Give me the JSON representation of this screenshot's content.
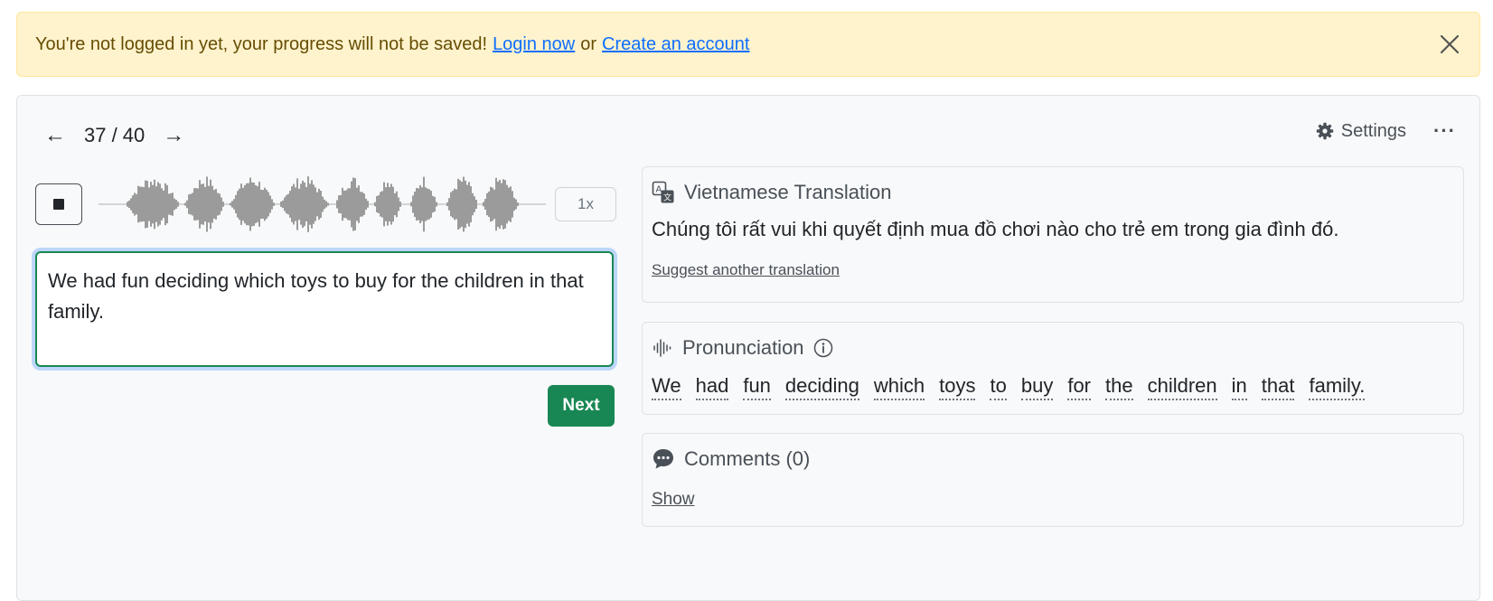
{
  "alert": {
    "message": "You're not logged in yet, your progress will not be saved!",
    "login_label": "Login now",
    "or_text": "or",
    "create_label": "Create an account"
  },
  "nav": {
    "prev_arrow": "←",
    "progress": "37 / 40",
    "next_arrow": "→"
  },
  "toolbar": {
    "settings_label": "Settings",
    "more_label": "···"
  },
  "player": {
    "speed_label": "1x"
  },
  "answer": {
    "value": "We had fun deciding which toys to buy for the children in that family."
  },
  "next_label": "Next",
  "translation": {
    "title": "Vietnamese Translation",
    "text": "Chúng tôi rất vui khi quyết định mua đồ chơi nào cho trẻ em trong gia đình đó.",
    "suggest_label": "Suggest another translation"
  },
  "pronunciation": {
    "title": "Pronunciation",
    "words": [
      "We",
      "had",
      "fun",
      "deciding",
      "which",
      "toys",
      "to",
      "buy",
      "for",
      "the",
      "children",
      "in",
      "that",
      "family."
    ]
  },
  "comments": {
    "title": "Comments (0)",
    "show_label": "Show"
  },
  "icons": {
    "close": "close-icon",
    "settings": "gear-icon",
    "translate": "translate-icon",
    "audio": "waveform-icon",
    "info": "info-icon",
    "chat": "chat-bubble-icon"
  },
  "colors": {
    "alert_bg": "#fff3cd",
    "link": "#0d6efd",
    "next_button": "#198754",
    "waveform": "#9b9b9b"
  }
}
